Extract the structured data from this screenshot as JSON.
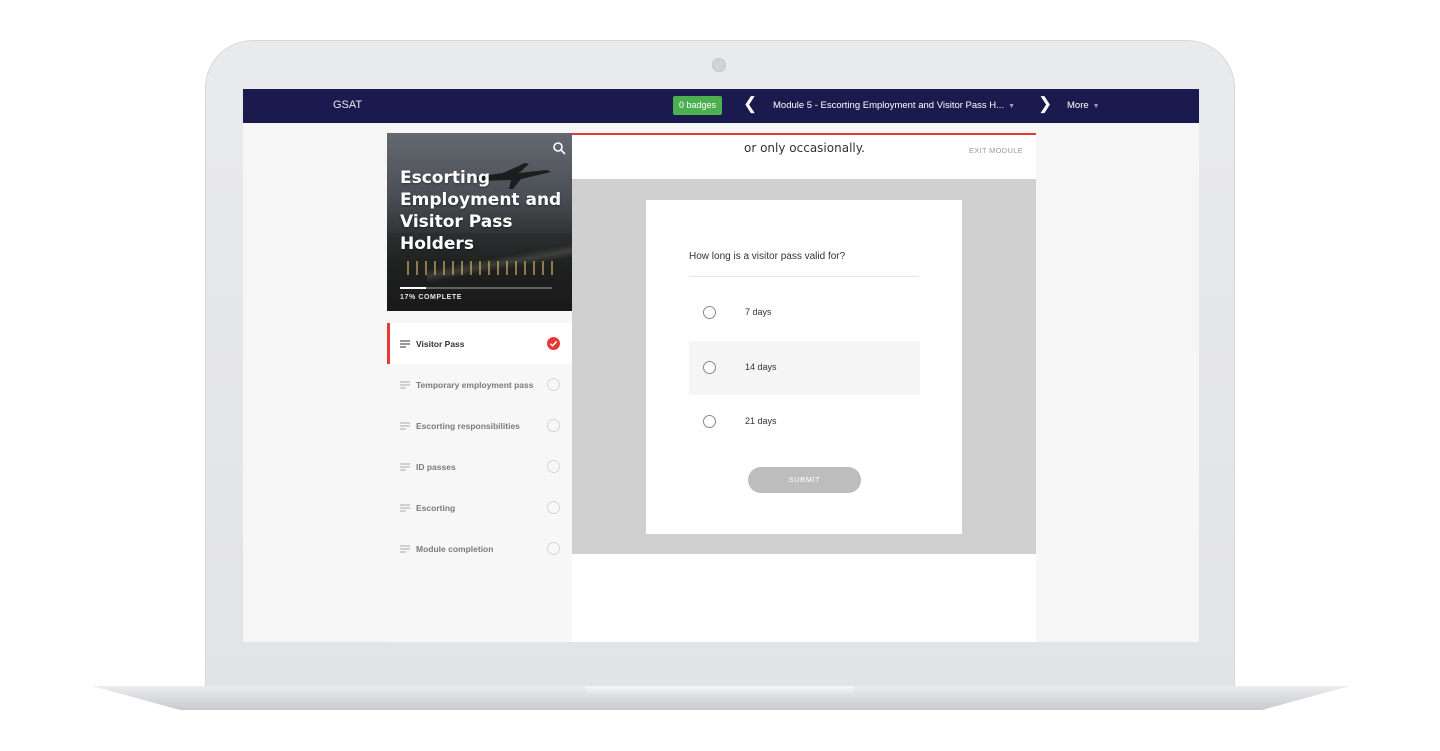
{
  "topbar": {
    "brand": "GSAT",
    "badges": "0 badges",
    "module_title": "Module 5 - Escorting Employment and Visitor Pass H...",
    "more": "More"
  },
  "sidebar": {
    "title": "Escorting Employment and Visitor Pass Holders",
    "progress_label": "17% COMPLETE",
    "progress_fraction": 0.17,
    "lessons": [
      {
        "label": "Visitor Pass",
        "status": "complete",
        "active": true
      },
      {
        "label": "Temporary employment pass",
        "status": "incomplete",
        "active": false
      },
      {
        "label": "Escorting responsibilities",
        "status": "incomplete",
        "active": false
      },
      {
        "label": "ID passes",
        "status": "incomplete",
        "active": false
      },
      {
        "label": "Escorting",
        "status": "incomplete",
        "active": false
      },
      {
        "label": "Module completion",
        "status": "incomplete",
        "active": false
      }
    ]
  },
  "content": {
    "text_fragment": "or only occasionally.",
    "exit_label": "EXIT MODULE"
  },
  "quiz": {
    "question": "How long is a visitor pass valid for?",
    "choices": [
      "7 days",
      "14 days",
      "21 days"
    ],
    "submit_label": "SUBMIT"
  },
  "colors": {
    "topbar": "#1a1a4e",
    "accent_red": "#e53935",
    "badge_green": "#4caf50",
    "quiz_band": "#d0d0d0"
  },
  "icons": {
    "prev": "chevron-left-icon",
    "next": "chevron-right-icon",
    "search": "search-icon",
    "lesson": "lesson-lines-icon",
    "complete": "check-circle-icon"
  }
}
